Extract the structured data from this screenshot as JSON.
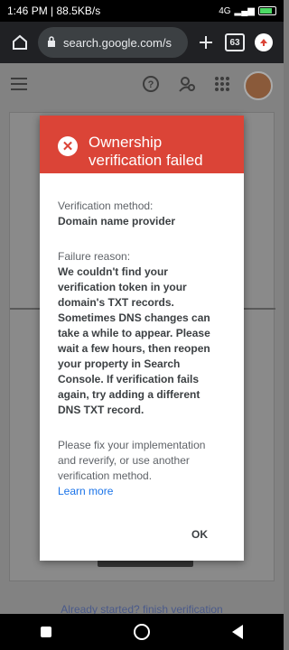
{
  "status": {
    "time": "1:46 PM",
    "speed": "88.5KB/s",
    "network": "4G"
  },
  "browser": {
    "url": "search.google.com/s",
    "tab_count": "63"
  },
  "background": {
    "bottom_link": "Already started? finish verification"
  },
  "dialog": {
    "title": "Ownership verification failed",
    "method_label": "Verification method:",
    "method_value": "Domain name provider",
    "reason_label": "Failure reason:",
    "reason_text": "We couldn't find your verification token in your domain's TXT records. Sometimes DNS changes can take a while to appear. Please wait a few hours, then reopen your property in Search Console. If verification fails again, try adding a different DNS TXT record.",
    "fix_text": "Please fix your implementation and reverify, or use another verification method.",
    "learn_more": "Learn more",
    "ok_label": "OK"
  },
  "colors": {
    "error_red": "#db4437",
    "link_blue": "#1a73e8",
    "toolbar": "#202124"
  },
  "icons": [
    "home-icon",
    "lock-icon",
    "plus-icon",
    "tabs-icon",
    "update-icon",
    "menu-icon",
    "help-icon",
    "user-settings-icon",
    "apps-icon",
    "error-icon"
  ]
}
